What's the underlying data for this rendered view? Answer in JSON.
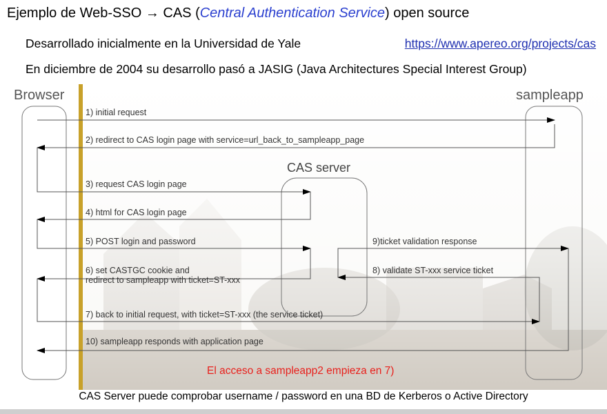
{
  "header": {
    "title_prefix": "Ejemplo de Web-SSO → CAS (",
    "title_em": "Central Authentication Service",
    "title_suffix": ") open source",
    "line1": "Desarrollado inicialmente en la Universidad de Yale",
    "link": "https://www.apereo.org/projects/cas",
    "line2": "En diciembre de 2004 su desarrollo pasó a JASIG (Java Architectures Special Interest Group)"
  },
  "diagram": {
    "actors": {
      "browser": "Browser",
      "sampleapp": "sampleapp",
      "cas": "CAS server"
    },
    "messages": [
      "1) initial request",
      "2) redirect to CAS login page with service=url_back_to_sampleapp_page",
      "3) request CAS login page",
      "4) html for CAS login page",
      "5) POST login and password",
      "6) set CASTGC cookie and",
      "redirect to sampleapp with ticket=ST-xxx",
      "7) back to initial request, with ticket=ST-xxx (the service ticket)",
      "10) sampleapp responds with application page",
      "9)ticket validation response",
      "8) validate ST-xxx service ticket"
    ],
    "note": "El acceso a sampleapp2 empieza en 7)"
  },
  "footer": "CAS Server puede comprobar username / password en una BD de Kerberos o Active Directory",
  "colors": {
    "gold_bar": "#c8a12a",
    "note_red": "#e8201c",
    "emphasis_blue": "#2a3fcf",
    "line_gray": "#555555"
  }
}
